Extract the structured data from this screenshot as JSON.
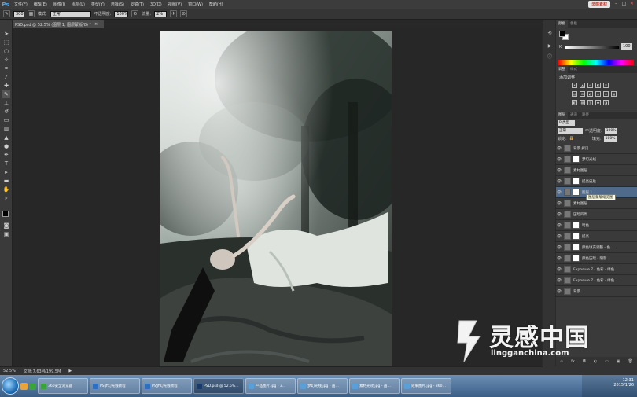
{
  "menubar": {
    "logo": "Ps",
    "items": [
      "文件(F)",
      "编辑(E)",
      "图像(I)",
      "图层(L)",
      "类型(Y)",
      "选择(S)",
      "滤镜(T)",
      "3D(D)",
      "视图(V)",
      "窗口(W)",
      "帮助(H)"
    ],
    "badge": "灵感素材"
  },
  "options": {
    "brush_size": "300",
    "mode_label": "模式:",
    "mode_value": "正常",
    "opacity_label": "不透明度:",
    "opacity_value": "100%",
    "flow_label": "流量:",
    "flow_value": "2%"
  },
  "document": {
    "tab_title": "PSD.psd @ 52.5% (图层 1, 图层蒙版/8) *",
    "close": "×"
  },
  "status": {
    "zoom": "52.5%",
    "doc_size": "文档:7.63M/199.5M"
  },
  "color_panel": {
    "tabs": [
      "颜色",
      "色板"
    ],
    "k_label": "K",
    "k_value": "100",
    "colors": {
      "fg": "#000000",
      "bg": "#ffffff"
    }
  },
  "adjustments_panel": {
    "tabs": [
      "调整",
      "样式"
    ],
    "title": "添加调整"
  },
  "layers_panel": {
    "tabs": [
      "图层",
      "通道",
      "路径"
    ],
    "filter_label": "P 类型",
    "blend_mode": "正常",
    "opacity_label": "不透明度:",
    "opacity_value": "100%",
    "lock_label": "锁定:",
    "fill_label": "填充:",
    "fill_value": "100%",
    "layers": [
      {
        "name": "背景 拷贝",
        "selected": false,
        "mask": false
      },
      {
        "name": "梦幻光线",
        "selected": false,
        "mask": true
      },
      {
        "name": "素材图层",
        "selected": false,
        "mask": false
      },
      {
        "name": "提亮皮肤",
        "selected": false,
        "mask": true
      },
      {
        "name": "图层 1",
        "selected": true,
        "mask": true
      },
      {
        "name": "素材图层",
        "selected": false,
        "mask": false
      },
      {
        "name": "压暗四周",
        "selected": false,
        "mask": false
      },
      {
        "name": "暗色",
        "selected": false,
        "mask": true
      },
      {
        "name": "提高",
        "selected": false,
        "mask": true
      },
      {
        "name": "颜色填充调整 - 色…",
        "selected": false,
        "mask": true
      },
      {
        "name": "颜色压暗 - 阴影…",
        "selected": false,
        "mask": true
      },
      {
        "name": "Exposure 7 - 色彩 - 绿色…",
        "selected": false,
        "mask": false
      },
      {
        "name": "Exposure 7 - 色彩 - 绿色…",
        "selected": false,
        "mask": false
      },
      {
        "name": "背景",
        "selected": false,
        "mask": false
      }
    ],
    "tooltip": "图层蒙版缩览图"
  },
  "watermark": {
    "cn": "灵感中国",
    "en": "lingganchina.com"
  },
  "taskbar": {
    "buttons": [
      {
        "label": "360安全浏览器",
        "color": "#3aa33a"
      },
      {
        "label": "PS梦幻光线教程",
        "color": "#2e6fbf"
      },
      {
        "label": "PS梦幻光线教程",
        "color": "#2e6fbf"
      },
      {
        "label": "PSD.psd @ 52.5%…",
        "color": "#1a3b6a",
        "active": true
      },
      {
        "label": "产品图片.jpg - 3…",
        "color": "#5aa0d8"
      },
      {
        "label": "梦幻光线.jpg - 画…",
        "color": "#5aa0d8"
      },
      {
        "label": "素材光效.jpg - 画…",
        "color": "#5aa0d8"
      },
      {
        "label": "效果图片.jpg - 360…",
        "color": "#5aa0d8"
      }
    ],
    "time": "12:31",
    "date": "2015/1/26"
  }
}
